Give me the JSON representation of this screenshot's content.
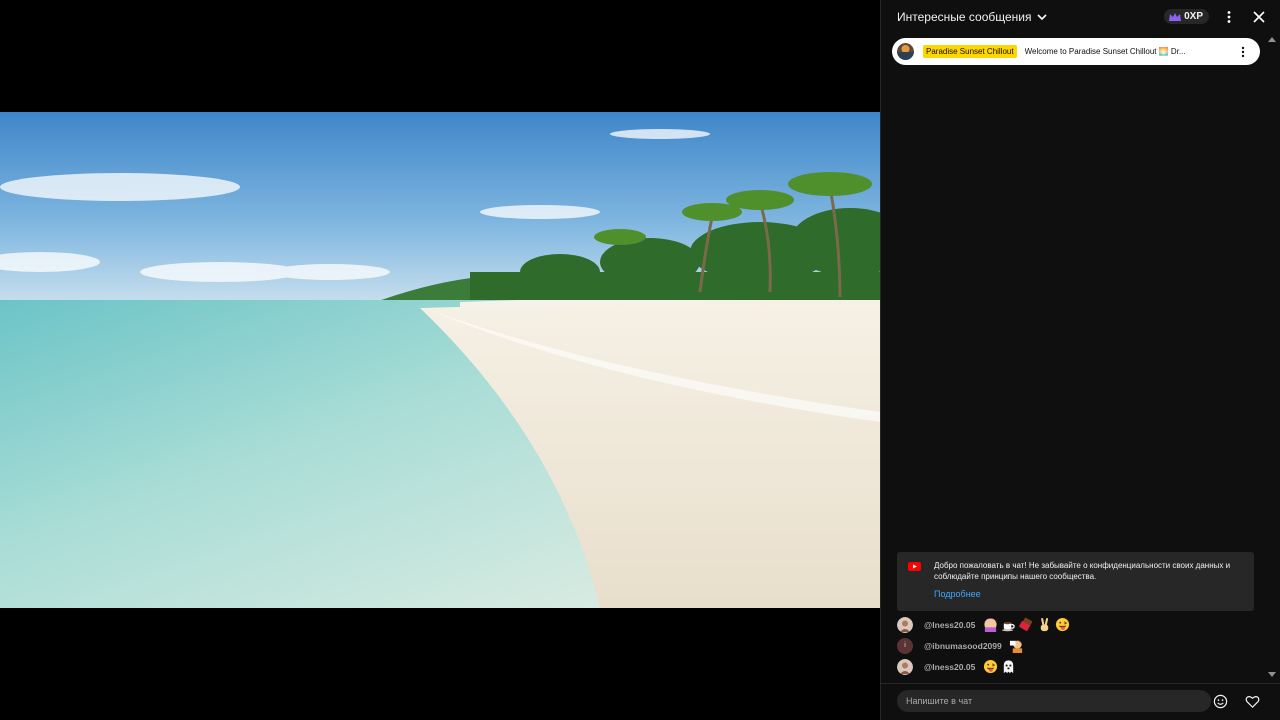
{
  "chat": {
    "title": "Интересные сообщения",
    "xp": "0XP",
    "pinned": {
      "channel": "Paradise Sunset Chillout",
      "text": "Welcome to Paradise Sunset Chillout 🌅 Dr..."
    },
    "welcome": {
      "text": "Добро пожаловать в чат! Не забывайте о конфиденциальности своих данных и соблюдайте принципы нашего сообщества.",
      "link": "Подробнее"
    },
    "messages": [
      {
        "author": "@Iness20.05",
        "avatar_letter": "",
        "emojis": [
          "woman-raising-hand",
          "coffee",
          "chocolate",
          "victory-hand",
          "tongue-face"
        ]
      },
      {
        "author": "@ibnumasood2099",
        "avatar_letter": "i",
        "emojis": [
          "person-with-sign"
        ]
      },
      {
        "author": "@Iness20.05",
        "avatar_letter": "",
        "emojis": [
          "tongue-face",
          "ghost"
        ]
      }
    ],
    "input_placeholder": "Напишите в чат"
  },
  "colors": {
    "chat_bg": "#0f0f0f",
    "panel_bg": "#272727",
    "link": "#3ea6ff",
    "channel_highlight": "#ffd600",
    "youtube_red": "#ff0000"
  }
}
